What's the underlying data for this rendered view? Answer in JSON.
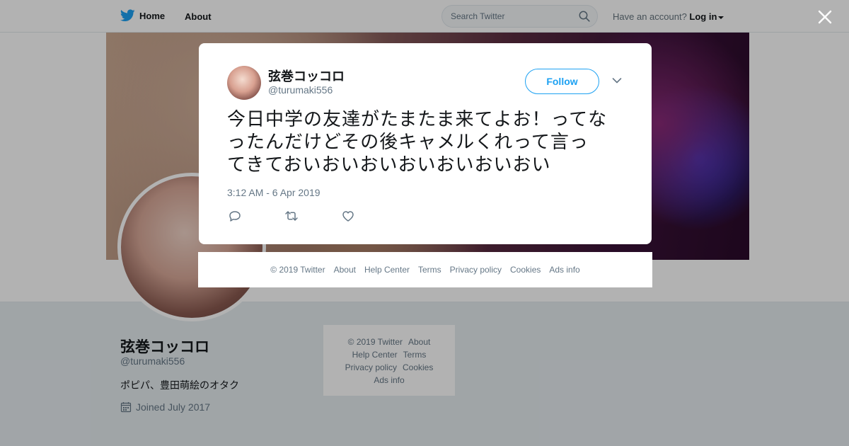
{
  "nav": {
    "home": "Home",
    "about": "About",
    "search_placeholder": "Search Twitter",
    "account_prompt": "Have an account?",
    "login": "Log in"
  },
  "profile": {
    "name": "弦巻コッコロ",
    "handle": "@turumaki556",
    "bio": "ポピパ、豊田萌絵のオタク",
    "joined": "Joined July 2017"
  },
  "side_footer": {
    "links": [
      "© 2019 Twitter",
      "About",
      "Help Center",
      "Terms",
      "Privacy policy",
      "Cookies",
      "Ads info"
    ]
  },
  "tweet": {
    "name": "弦巻コッコロ",
    "handle": "@turumaki556",
    "follow_label": "Follow",
    "text_lines": [
      "今日中学の友達がたまたま来てよお！ってな",
      "ったんだけどその後キャメルくれって言っ",
      "てきておいおいおいおいおいおいおい"
    ],
    "timestamp": "3:12 AM - 6 Apr 2019"
  },
  "modal_footer": {
    "links": [
      "© 2019 Twitter",
      "About",
      "Help Center",
      "Terms",
      "Privacy policy",
      "Cookies",
      "Ads info"
    ]
  },
  "colors": {
    "accent": "#1da1f2",
    "text_primary": "#14171a",
    "text_secondary": "#657786",
    "page_bg": "#e6ecf0"
  },
  "icons": {
    "logo": "twitter-bird-icon",
    "search": "search-icon",
    "close": "close-icon",
    "chevron": "chevron-down-icon",
    "reply": "reply-icon",
    "retweet": "retweet-icon",
    "like": "heart-icon",
    "calendar": "calendar-icon"
  }
}
